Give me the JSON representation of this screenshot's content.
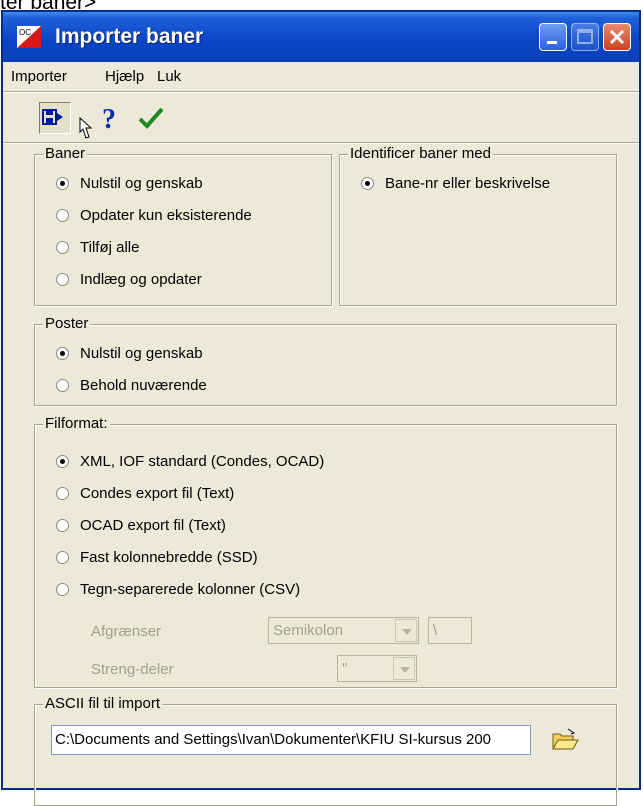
{
  "page_title_fragment": "ter baner>",
  "window": {
    "title": "Importer baner"
  },
  "menu": [
    "Importer",
    "Hjælp",
    "Luk"
  ],
  "toolbar": {
    "import_icon": "import-arrow-icon",
    "help_icon": "help-icon",
    "ok_icon": "checkmark-icon"
  },
  "baner": {
    "label": "Baner",
    "options": [
      "Nulstil og genskab",
      "Opdater kun eksisterende",
      "Tilføj alle",
      "Indlæg og opdater"
    ],
    "selected": 0
  },
  "identify": {
    "label": "Identificer baner med",
    "options": [
      "Bane-nr eller beskrivelse"
    ],
    "selected": 0
  },
  "poster": {
    "label": "Poster",
    "options": [
      "Nulstil og genskab",
      "Behold nuværende"
    ],
    "selected": 0
  },
  "filformat": {
    "label": "Filformat:",
    "options": [
      "XML, IOF standard (Condes, OCAD)",
      "Condes export fil (Text)",
      "OCAD export fil (Text)",
      "Fast kolonnebredde (SSD)",
      "Tegn-separerede kolonner (CSV)"
    ],
    "selected": 0,
    "delimiter_label": "Afgrænser",
    "delimiter_value": "Semikolon",
    "escape_value": "\\",
    "string_label": "Streng-deler",
    "string_value": "\""
  },
  "ascii": {
    "label": "ASCII fil til import",
    "path": "C:\\Documents and Settings\\Ivan\\Dokumenter\\KFIU SI-kursus 200"
  },
  "colors": {
    "titlebar": "#0a46c8",
    "dialog": "#ece9d8",
    "close": "#c8421e"
  }
}
